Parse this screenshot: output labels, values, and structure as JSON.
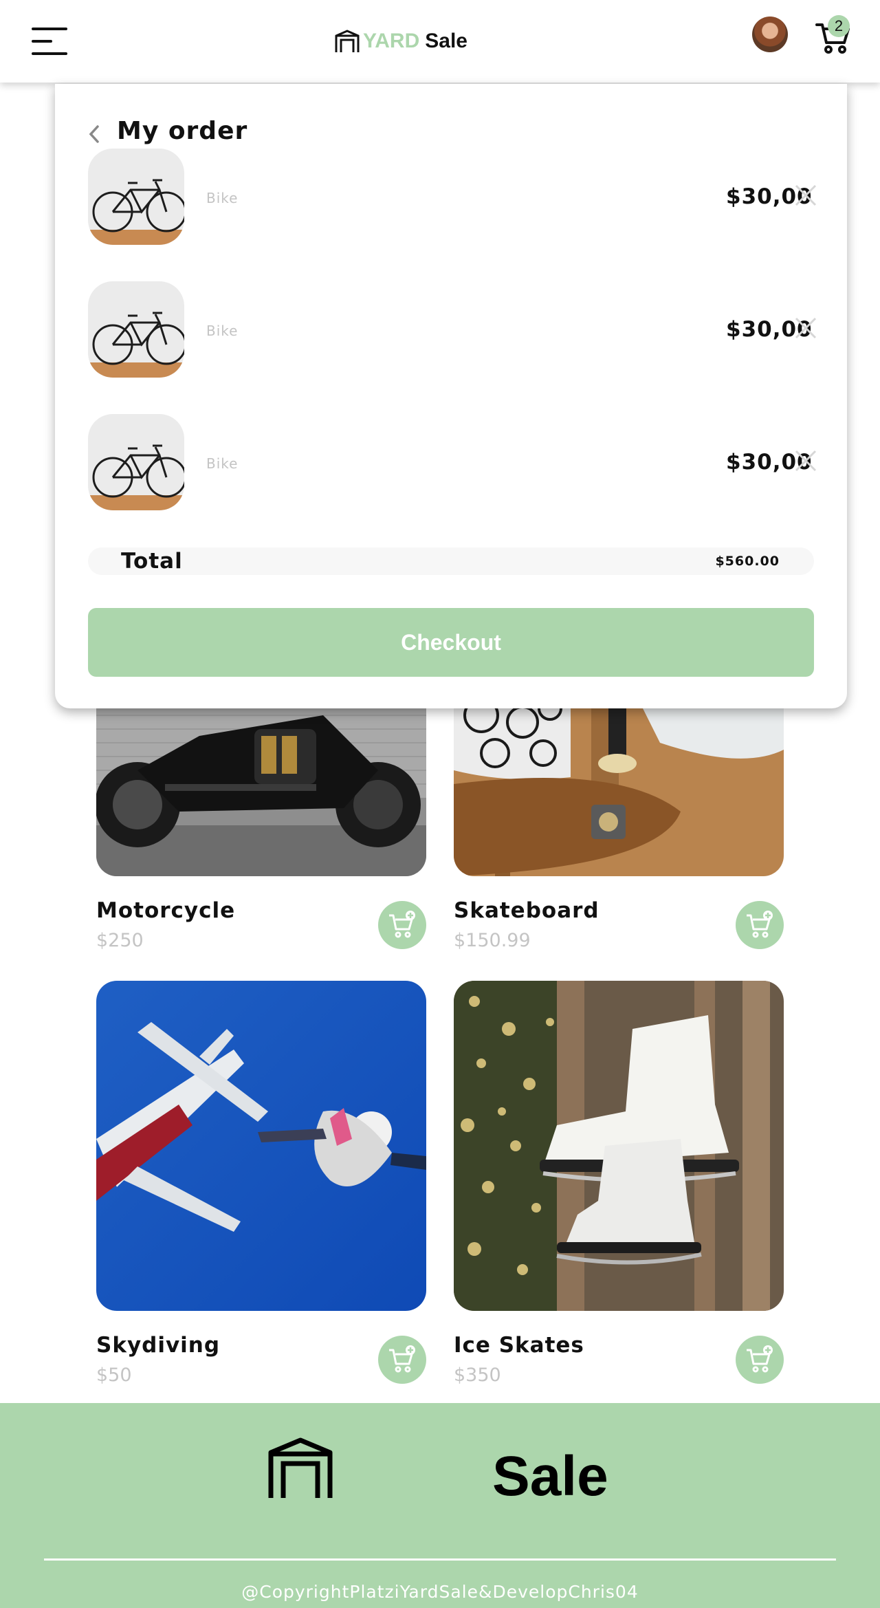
{
  "header": {
    "logo_yard": "YARD",
    "logo_sale": "Sale",
    "cart_count": "2"
  },
  "order": {
    "title": "My order",
    "items": [
      {
        "name": "Bike",
        "price": "$30,00"
      },
      {
        "name": "Bike",
        "price": "$30,00"
      },
      {
        "name": "Bike",
        "price": "$30,00"
      }
    ],
    "total_label": "Total",
    "total_value": "$560.00",
    "checkout_label": "Checkout"
  },
  "products": [
    {
      "name": "Motorcycle",
      "price": "$250"
    },
    {
      "name": "Skateboard",
      "price": "$150.99"
    },
    {
      "name": "Skydiving",
      "price": "$50"
    },
    {
      "name": "Ice Skates",
      "price": "$350"
    }
  ],
  "footer": {
    "sale": "Sale",
    "copyright": "@CopyrightPlatziYardSale&DevelopChris04"
  },
  "colors": {
    "accent": "#acd6ac",
    "muted_text": "#c4c4c4"
  }
}
